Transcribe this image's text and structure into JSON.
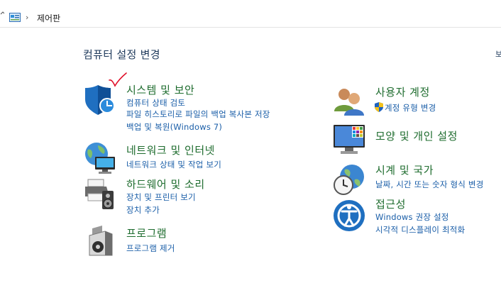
{
  "address_bar": {
    "crumb": "제어판"
  },
  "heading": "컴퓨터 설정 변경",
  "view_by_fragment": "보",
  "categories": {
    "system_security": {
      "title": "시스템 및 보안",
      "links": [
        "컴퓨터 상태 검토",
        "파일 히스토리로 파일의 백업 복사본 저장",
        "백업 및 복원(Windows 7)"
      ]
    },
    "network_internet": {
      "title": "네트워크 및 인터넷",
      "links": [
        "네트워크 상태 및 작업 보기"
      ]
    },
    "hardware_sound": {
      "title": "하드웨어 및 소리",
      "links": [
        "장치 및 프린터 보기",
        "장치 추가"
      ]
    },
    "programs": {
      "title": "프로그램",
      "links": [
        "프로그램 제거"
      ]
    },
    "user_accounts": {
      "title": "사용자 계정",
      "links": [
        "계정 유형 변경"
      ]
    },
    "appearance": {
      "title": "모양 및 개인 설정",
      "links": []
    },
    "clock_region": {
      "title": "시계 및 국가",
      "links": [
        "날짜, 시간 또는 숫자 형식 변경"
      ]
    },
    "ease_of_access": {
      "title": "접근성",
      "links": [
        "Windows 권장 설정",
        "시각적 디스플레이 최적화"
      ]
    }
  },
  "colors": {
    "category_title": "#1e6c2e",
    "link": "#1a5ea8",
    "heading": "#1e395b",
    "annotation_mark": "#e0102a"
  }
}
